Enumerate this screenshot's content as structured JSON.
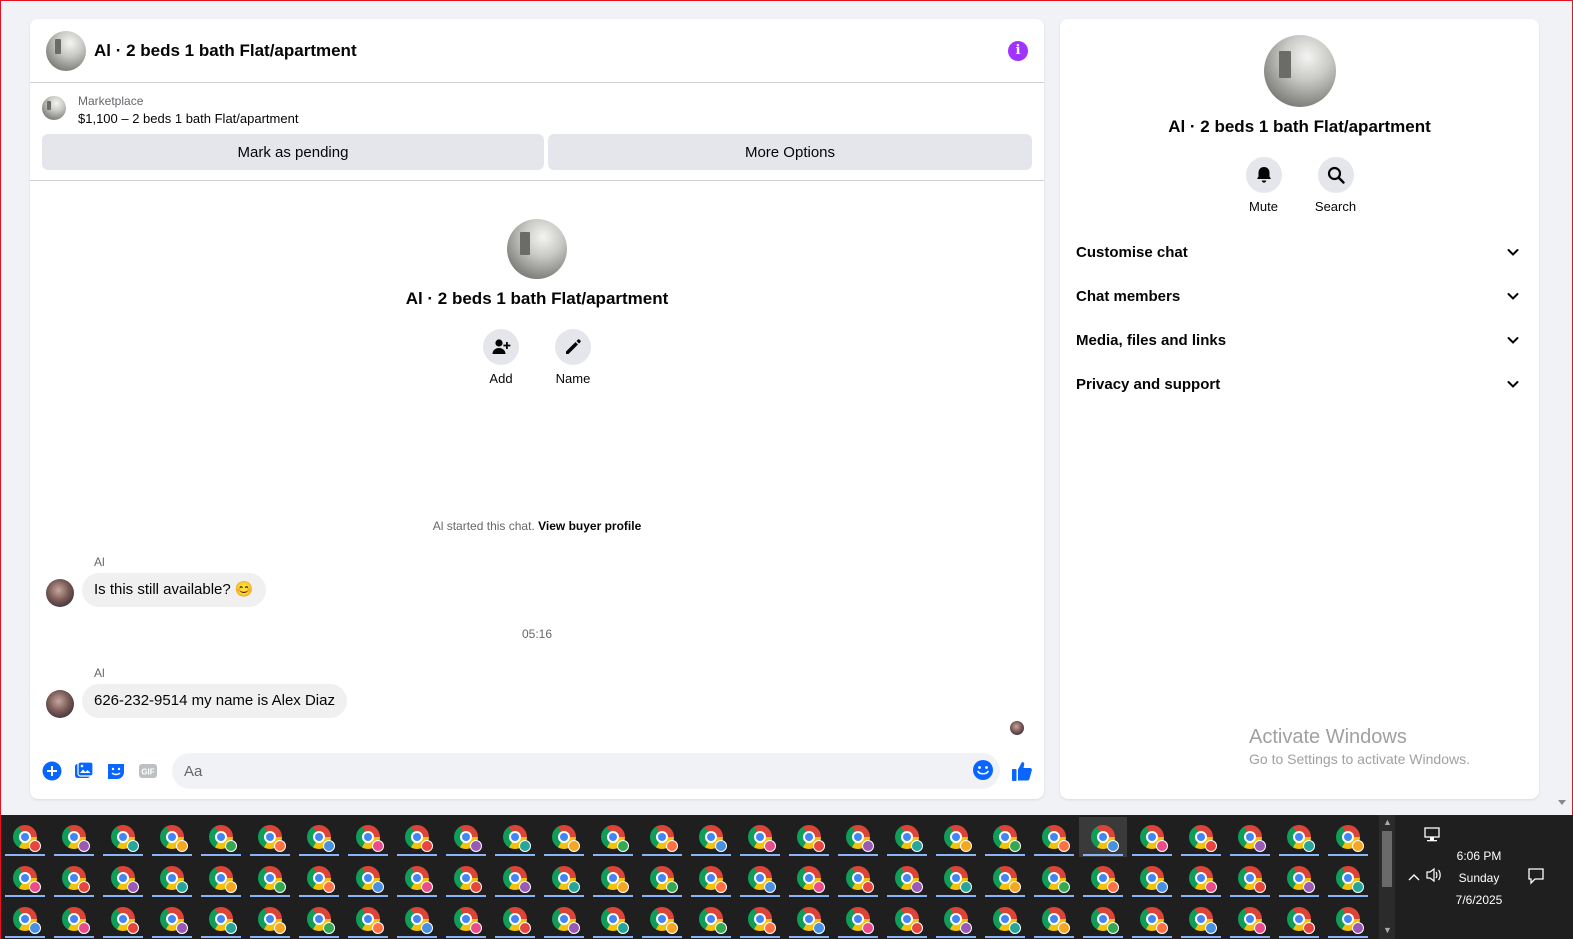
{
  "chat": {
    "title": "Al · 2 beds 1 bath Flat/apartment",
    "marketplace_label": "Marketplace",
    "listing": "$1,100 – 2 beds 1 bath Flat/apartment",
    "mark_pending": "Mark as pending",
    "more_options": "More Options",
    "intro_title": "Al · 2 beds 1 bath Flat/apartment",
    "add_label": "Add",
    "name_label": "Name",
    "started_text": "Al started this chat.",
    "view_buyer": "View buyer profile",
    "messages": [
      {
        "sender": "Al",
        "text": "Is this still available? 😊"
      },
      {
        "sender": "Al",
        "text": "626-232-9514 my name is Alex Diaz"
      }
    ],
    "timestamp": "05:16",
    "composer_placeholder": "Aa"
  },
  "info": {
    "title": "Al · 2 beds 1 bath Flat/apartment",
    "mute_label": "Mute",
    "search_label": "Search",
    "sections": [
      "Customise chat",
      "Chat members",
      "Media, files and links",
      "Privacy and support"
    ]
  },
  "watermark": {
    "title": "Activate Windows",
    "subtitle": "Go to Settings to activate Windows."
  },
  "taskbar": {
    "time": "6:06 PM",
    "day": "Sunday",
    "date": "7/6/2025"
  },
  "colors": {
    "accent": "#0866ff",
    "info": "#a033ff"
  }
}
